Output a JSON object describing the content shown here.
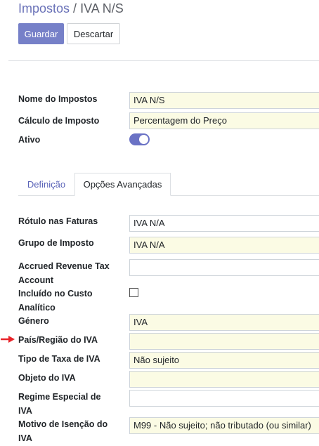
{
  "breadcrumb": {
    "parent": "Impostos",
    "separator": "/",
    "current": "IVA N/S"
  },
  "toolbar": {
    "save_label": "Guardar",
    "discard_label": "Descartar"
  },
  "main": {
    "name_label": "Nome do Impostos",
    "name_value": "IVA N/S",
    "computation_label": "Cálculo de Imposto",
    "computation_value": "Percentagem do Preço",
    "active_label": "Ativo",
    "active_value": true
  },
  "tabs": {
    "definition": "Definição",
    "advanced": "Opções Avançadas"
  },
  "advanced": {
    "invoice_label_label": "Rótulo nas Faturas",
    "invoice_label_value": "IVA N/A",
    "tax_group_label": "Grupo de Imposto",
    "tax_group_value": "IVA N/A",
    "accrued_label_line1": "Accrued Revenue Tax",
    "accrued_label_line2": "Account",
    "accrued_value": "",
    "analytic_label_line1": "Incluído no Custo",
    "analytic_label_line2": "Analítico",
    "analytic_checked": false,
    "genre_label": "Género",
    "genre_value": "IVA",
    "country_label": "País/Região do IVA",
    "country_value": "",
    "rate_type_label": "Tipo de Taxa de IVA",
    "rate_type_value": "Não sujeito",
    "object_label": "Objeto do IVA",
    "object_value": "",
    "special_regime_label_line1": "Regime Especial de",
    "special_regime_label_line2": "IVA",
    "special_regime_value": "",
    "exemption_label_line1": "Motivo de Isenção do",
    "exemption_label_line2": "IVA",
    "exemption_value": "M99 - Não sujeito; não tributado (ou similar)"
  },
  "colors": {
    "primary": "#7680c8",
    "required_field_bg": "#fbfbe4",
    "arrow": "#e8242a"
  },
  "icons": {
    "annotation_arrow": "red-arrow-icon"
  }
}
